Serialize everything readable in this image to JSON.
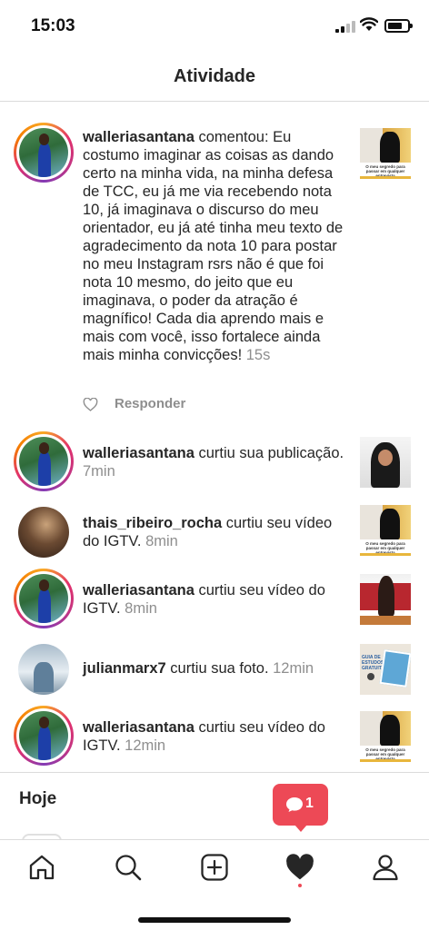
{
  "status_bar": {
    "time": "15:03"
  },
  "header": {
    "title": "Atividade"
  },
  "activities": [
    {
      "username": "walleriasantana",
      "text": " comentou: Eu costumo imaginar as coisas as dando certo na minha vida, na minha defesa de TCC, eu já me via recebendo nota 10, já imaginava o discurso do meu orientador, eu já até tinha meu texto de agradecimento da nota 10 para postar no meu Instagram rsrs não é que foi nota 10 mesmo, do jeito que eu imaginava, o poder da atração é magnífico! Cada dia aprendo mais e mais com você, isso fortalece ainda mais minha convicções!",
      "time": " 15s",
      "reply_label": "Responder",
      "thumb_caption": "O meu segredo para passar em qualquer entrevista"
    },
    {
      "username": "walleriasantana",
      "text": " curtiu sua publicação.",
      "time": " 7min"
    },
    {
      "username": "thais_ribeiro_rocha",
      "text": " curtiu seu vídeo do IGTV.",
      "time": " 8min",
      "thumb_caption": "O meu segredo para passar em qualquer entrevista"
    },
    {
      "username": "walleriasantana",
      "text": " curtiu seu vídeo do IGTV.",
      "time": " 8min"
    },
    {
      "username": "julianmarx7",
      "text": " curtiu sua foto.",
      "time": " 12min",
      "thumb_caption": "GUIA DE ESTUDOS GRATUITO"
    },
    {
      "username": "walleriasantana",
      "text": " curtiu seu vídeo do IGTV.",
      "time": " 12min",
      "thumb_caption": "O meu segredo para passar em qualquer entrevista"
    }
  ],
  "section": {
    "title": "Hoje"
  },
  "notification_badge": {
    "count": "1",
    "color": "#ed4956"
  },
  "tabbar": {
    "items": [
      {
        "icon": "home-icon"
      },
      {
        "icon": "search-icon"
      },
      {
        "icon": "add-post-icon"
      },
      {
        "icon": "heart-icon",
        "active": true
      },
      {
        "icon": "profile-icon"
      }
    ]
  }
}
